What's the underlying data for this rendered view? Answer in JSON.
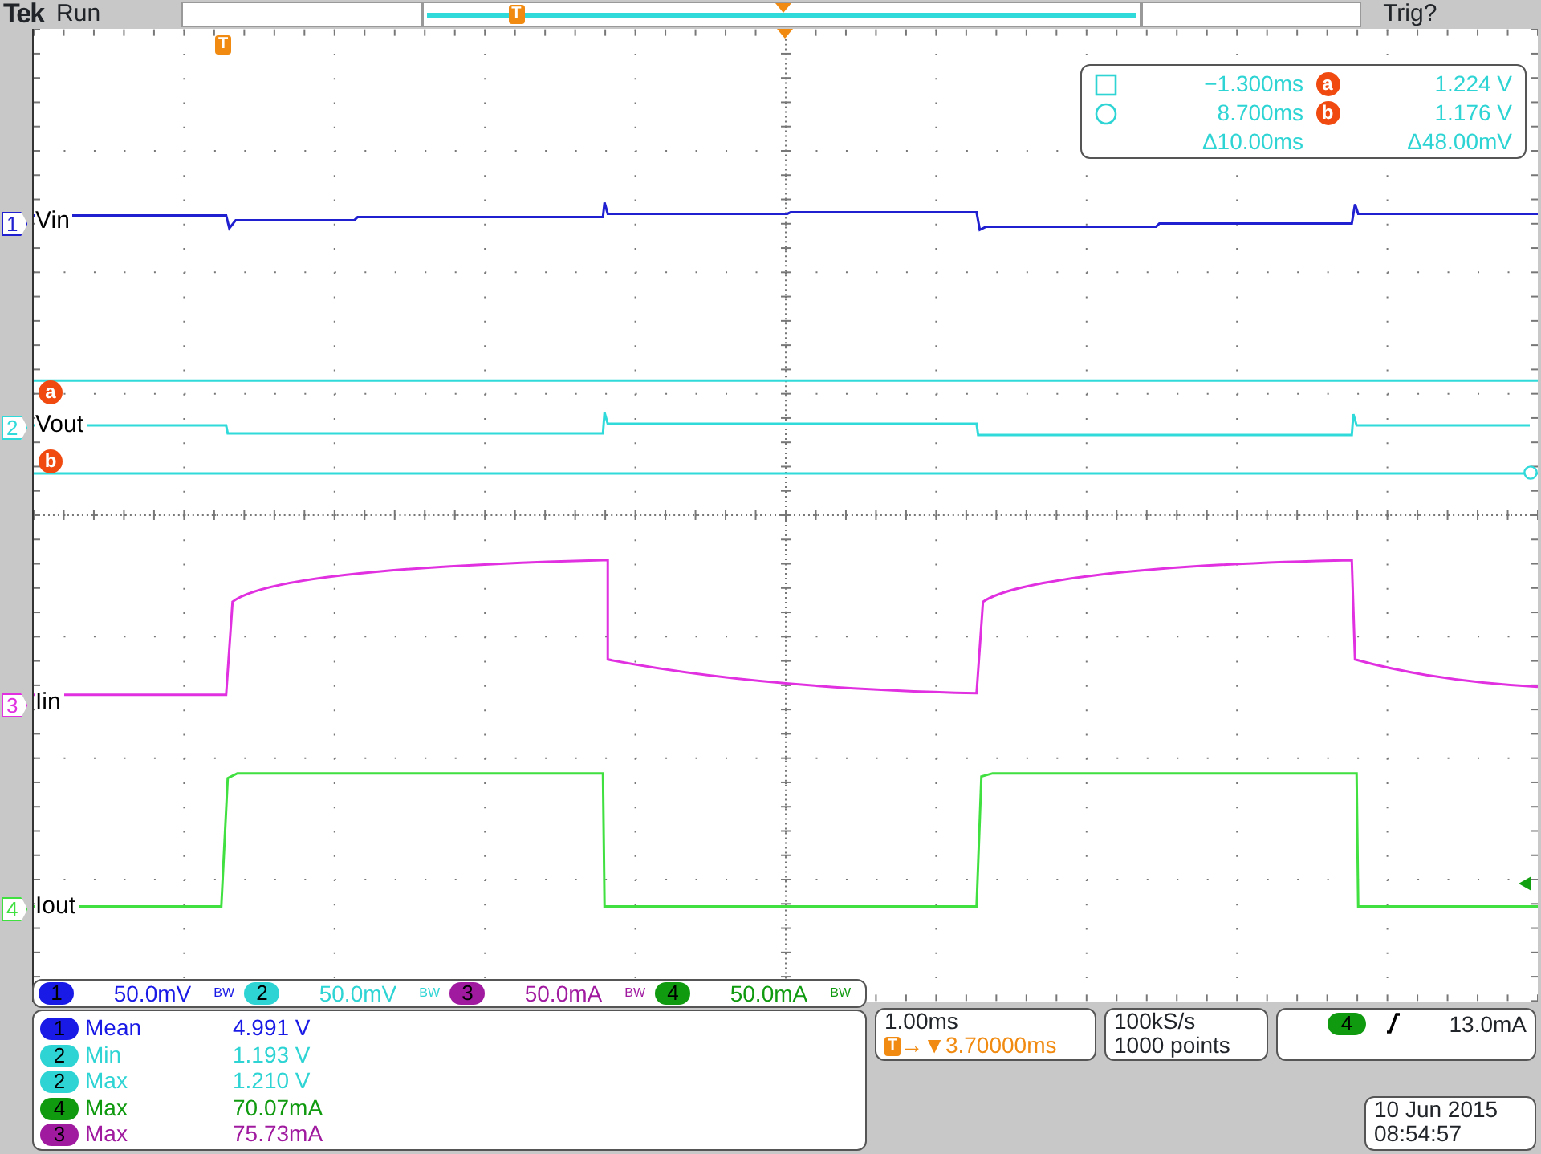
{
  "top_bar": {
    "brand": "Tek",
    "run_state": "Run",
    "record_marker": "T",
    "trigger_state": "Trig?"
  },
  "graticule": {
    "trigger_marker": "T"
  },
  "traces": [
    {
      "channel": "1",
      "label": "Vin",
      "color": "#2020d0"
    },
    {
      "channel": "2",
      "label": "Vout",
      "color": "#30dada"
    },
    {
      "channel": "3",
      "label": "Iin",
      "color": "#e030e0"
    },
    {
      "channel": "4",
      "label": "Iout",
      "color": "#40e040"
    }
  ],
  "cursors": [
    {
      "marker": "a"
    },
    {
      "marker": "b"
    }
  ],
  "cursor_readout": {
    "rows": [
      {
        "time": "−1.300ms",
        "marker": "a",
        "value": "1.224 V"
      },
      {
        "time": "8.700ms",
        "marker": "b",
        "value": "1.176 V"
      }
    ],
    "delta_time": "Δ10.00ms",
    "delta_value": "Δ48.00mV"
  },
  "channel_scales": [
    {
      "channel": "1",
      "scale": "50.0mV",
      "bw": "BW",
      "color": "#1a1ae6"
    },
    {
      "channel": "2",
      "scale": "50.0mV",
      "bw": "BW",
      "color": "#2ed4d4"
    },
    {
      "channel": "3",
      "scale": "50.0mA",
      "bw": "BW",
      "color": "#a01aa0"
    },
    {
      "channel": "4",
      "scale": "50.0mA",
      "bw": "BW",
      "color": "#109a10"
    }
  ],
  "measurements": [
    {
      "channel": "1",
      "name": "Mean",
      "value": "4.991 V",
      "color": "#1a1ae6"
    },
    {
      "channel": "2",
      "name": "Min",
      "value": "1.193 V",
      "color": "#2ed4d4"
    },
    {
      "channel": "2",
      "name": "Max",
      "value": "1.210 V",
      "color": "#2ed4d4"
    },
    {
      "channel": "4",
      "name": "Max",
      "value": "70.07mA",
      "color": "#109a10"
    },
    {
      "channel": "3",
      "name": "Max",
      "value": "75.73mA",
      "color": "#a01aa0"
    }
  ],
  "timebase": {
    "scale": "1.00ms",
    "trigger_marker": "T",
    "arrow": "→▼",
    "position": "3.70000ms"
  },
  "acquisition": {
    "sample_rate": "100kS/s",
    "record_length": "1000 points"
  },
  "trigger": {
    "channel": "4",
    "color": "#109a10",
    "level": "13.0mA"
  },
  "timestamp": {
    "date": "10 Jun 2015",
    "time": "08:54:57"
  }
}
